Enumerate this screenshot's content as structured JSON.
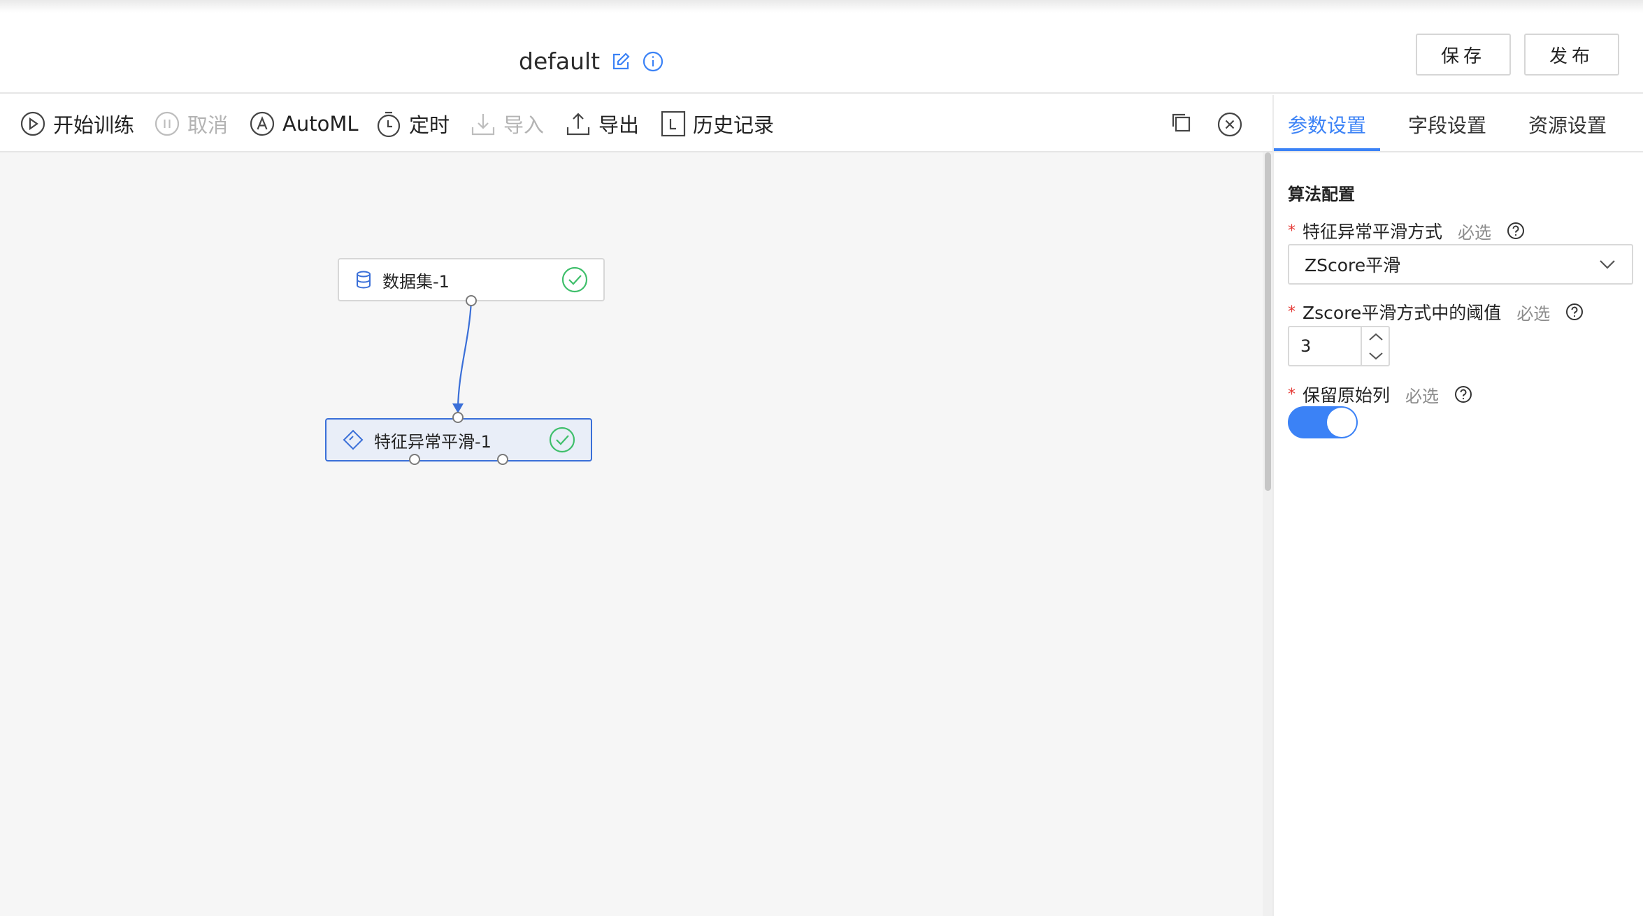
{
  "header": {
    "title": "default",
    "save_label": "保存",
    "publish_label": "发布"
  },
  "toolbar": {
    "items": [
      {
        "label": "开始训练",
        "icon": "play-circle-icon",
        "enabled": true
      },
      {
        "label": "取消",
        "icon": "pause-circle-icon",
        "enabled": false
      },
      {
        "label": "AutoML",
        "icon": "automl-icon",
        "enabled": true
      },
      {
        "label": "定时",
        "icon": "timer-icon",
        "enabled": true
      },
      {
        "label": "导入",
        "icon": "import-icon",
        "enabled": false
      },
      {
        "label": "导出",
        "icon": "export-icon",
        "enabled": true
      },
      {
        "label": "历史记录",
        "icon": "history-icon",
        "enabled": true
      }
    ],
    "right_icons": [
      "copy-icon",
      "close-circle-icon"
    ]
  },
  "canvas": {
    "nodes": [
      {
        "label": "数据集-1",
        "icon": "database-icon",
        "status": "success",
        "selected": false
      },
      {
        "label": "特征异常平滑-1",
        "icon": "transform-icon",
        "status": "success",
        "selected": true
      }
    ]
  },
  "panel": {
    "tabs": [
      {
        "label": "参数设置",
        "active": true
      },
      {
        "label": "字段设置",
        "active": false
      },
      {
        "label": "资源设置",
        "active": false
      }
    ],
    "section_title": "算法配置",
    "fields": {
      "method": {
        "label": "特征异常平滑方式",
        "required_text": "必选",
        "value": "ZScore平滑"
      },
      "threshold": {
        "label": "Zscore平滑方式中的阈值",
        "required_text": "必选",
        "value": "3"
      },
      "keep_original": {
        "label": "保留原始列",
        "required_text": "必选",
        "value": true
      }
    }
  },
  "colors": {
    "accent": "#3b82f6",
    "success": "#3fbf6b",
    "required": "#e53935",
    "canvas_bg": "#f6f6f6"
  }
}
